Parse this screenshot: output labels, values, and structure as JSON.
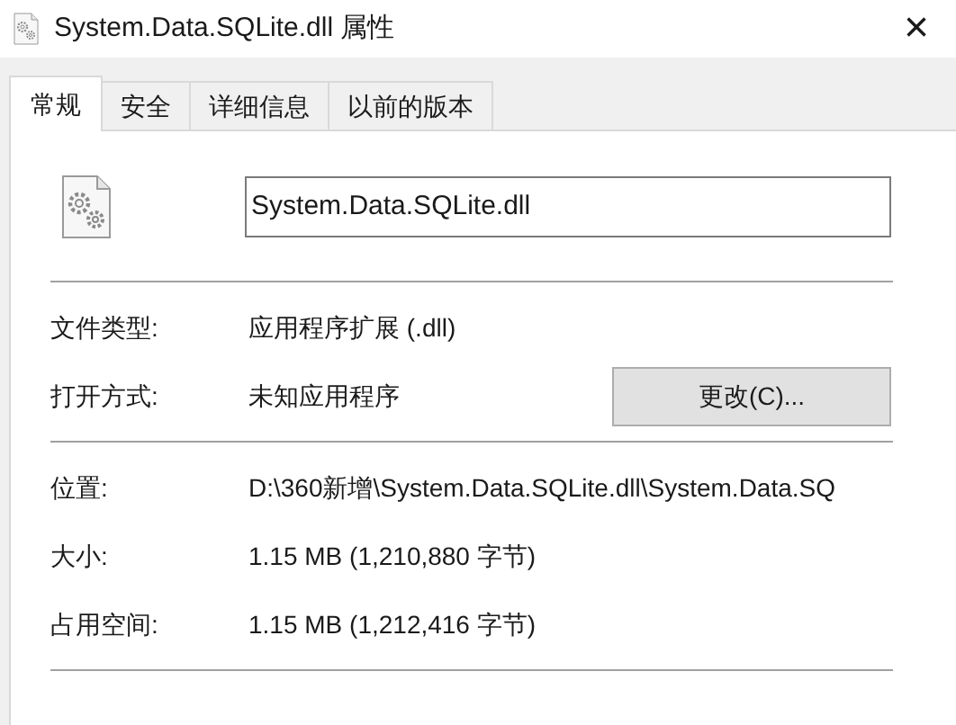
{
  "window": {
    "title": "System.Data.SQLite.dll 属性",
    "close": "×"
  },
  "tabs": [
    {
      "label": "常规",
      "selected": true
    },
    {
      "label": "安全",
      "selected": false
    },
    {
      "label": "详细信息",
      "selected": false
    },
    {
      "label": "以前的版本",
      "selected": false
    }
  ],
  "file_name": "System.Data.SQLite.dll",
  "type_section": [
    {
      "label": "文件类型:",
      "value": "应用程序扩展 (.dll)"
    },
    {
      "label": "打开方式:",
      "value": "未知应用程序",
      "button": "更改(C)..."
    }
  ],
  "details_section": [
    {
      "label": "位置:",
      "value": "D:\\360新增\\System.Data.SQLite.dll\\System.Data.SQ"
    },
    {
      "label": "大小:",
      "value": "1.15 MB (1,210,880 字节)"
    },
    {
      "label": "占用空间:",
      "value": "1.15 MB (1,212,416 字节)"
    }
  ]
}
